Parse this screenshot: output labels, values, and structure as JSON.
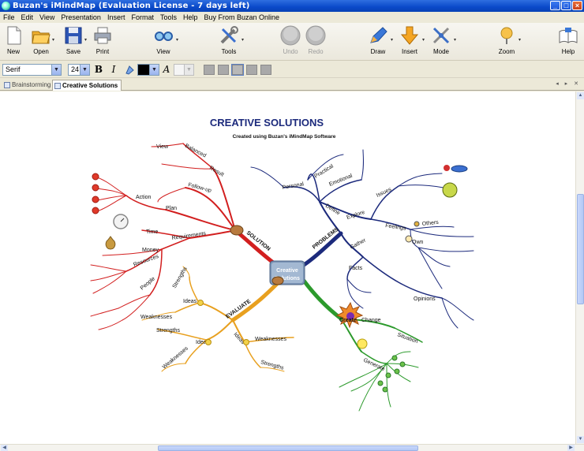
{
  "window": {
    "title": "Buzan's iMindMap  (Evaluation License - 7 days left)",
    "buttons": {
      "minimize": "_",
      "maximize": "□",
      "close": "×"
    }
  },
  "menu": [
    "File",
    "Edit",
    "View",
    "Presentation",
    "Insert",
    "Format",
    "Tools",
    "Help",
    "Buy From Buzan Online"
  ],
  "toolbar": {
    "new": "New",
    "open": "Open",
    "save": "Save",
    "print": "Print",
    "view": "View",
    "tools": "Tools",
    "undo": "Undo",
    "redo": "Redo",
    "draw": "Draw",
    "insert": "Insert",
    "mode": "Mode",
    "zoom": "Zoom",
    "help": "Help"
  },
  "format": {
    "font": "Serif",
    "size": "24",
    "bold": "B",
    "italic": "I",
    "text_style": "A",
    "text_color": "#000000"
  },
  "tabs": [
    {
      "label": "Brainstorming",
      "active": false
    },
    {
      "label": "Creative Solutions",
      "active": true
    }
  ],
  "mindmap": {
    "title": "CREATIVE SOLUTIONS",
    "subtitle": "Created using Buzan's iMindMap Software",
    "central": [
      "Creative",
      "Solutions"
    ],
    "branches": {
      "solution": {
        "label": "SOLUTION",
        "color": "#d21f1f",
        "labels": [
          "Balanced",
          "View",
          "Result",
          "Follow-up",
          "Action",
          "Plan",
          "Requirements",
          "Time",
          "Money",
          "Resources",
          "People"
        ]
      },
      "problems": {
        "label": "PROBLEMS",
        "color": "#1c2a7c",
        "labels": [
          "Practical",
          "Personal",
          "Emotional",
          "Define",
          "Explore",
          "Issues",
          "Feelings",
          "Others",
          "Own",
          "Gather",
          "Facts",
          "Opinions"
        ]
      },
      "evaluate": {
        "label": "EVALUATE",
        "color": "#e8a01f",
        "labels": [
          "Strengths",
          "Ideas",
          "Weaknesses",
          "Strengths",
          "Ideas",
          "Weaknesses",
          "Ideas",
          "Weaknesses",
          "Strengths"
        ]
      },
      "create": {
        "label": "Create",
        "color": "#2c9a2c",
        "labels": [
          "Change",
          "Situation",
          "Generate"
        ]
      }
    }
  }
}
